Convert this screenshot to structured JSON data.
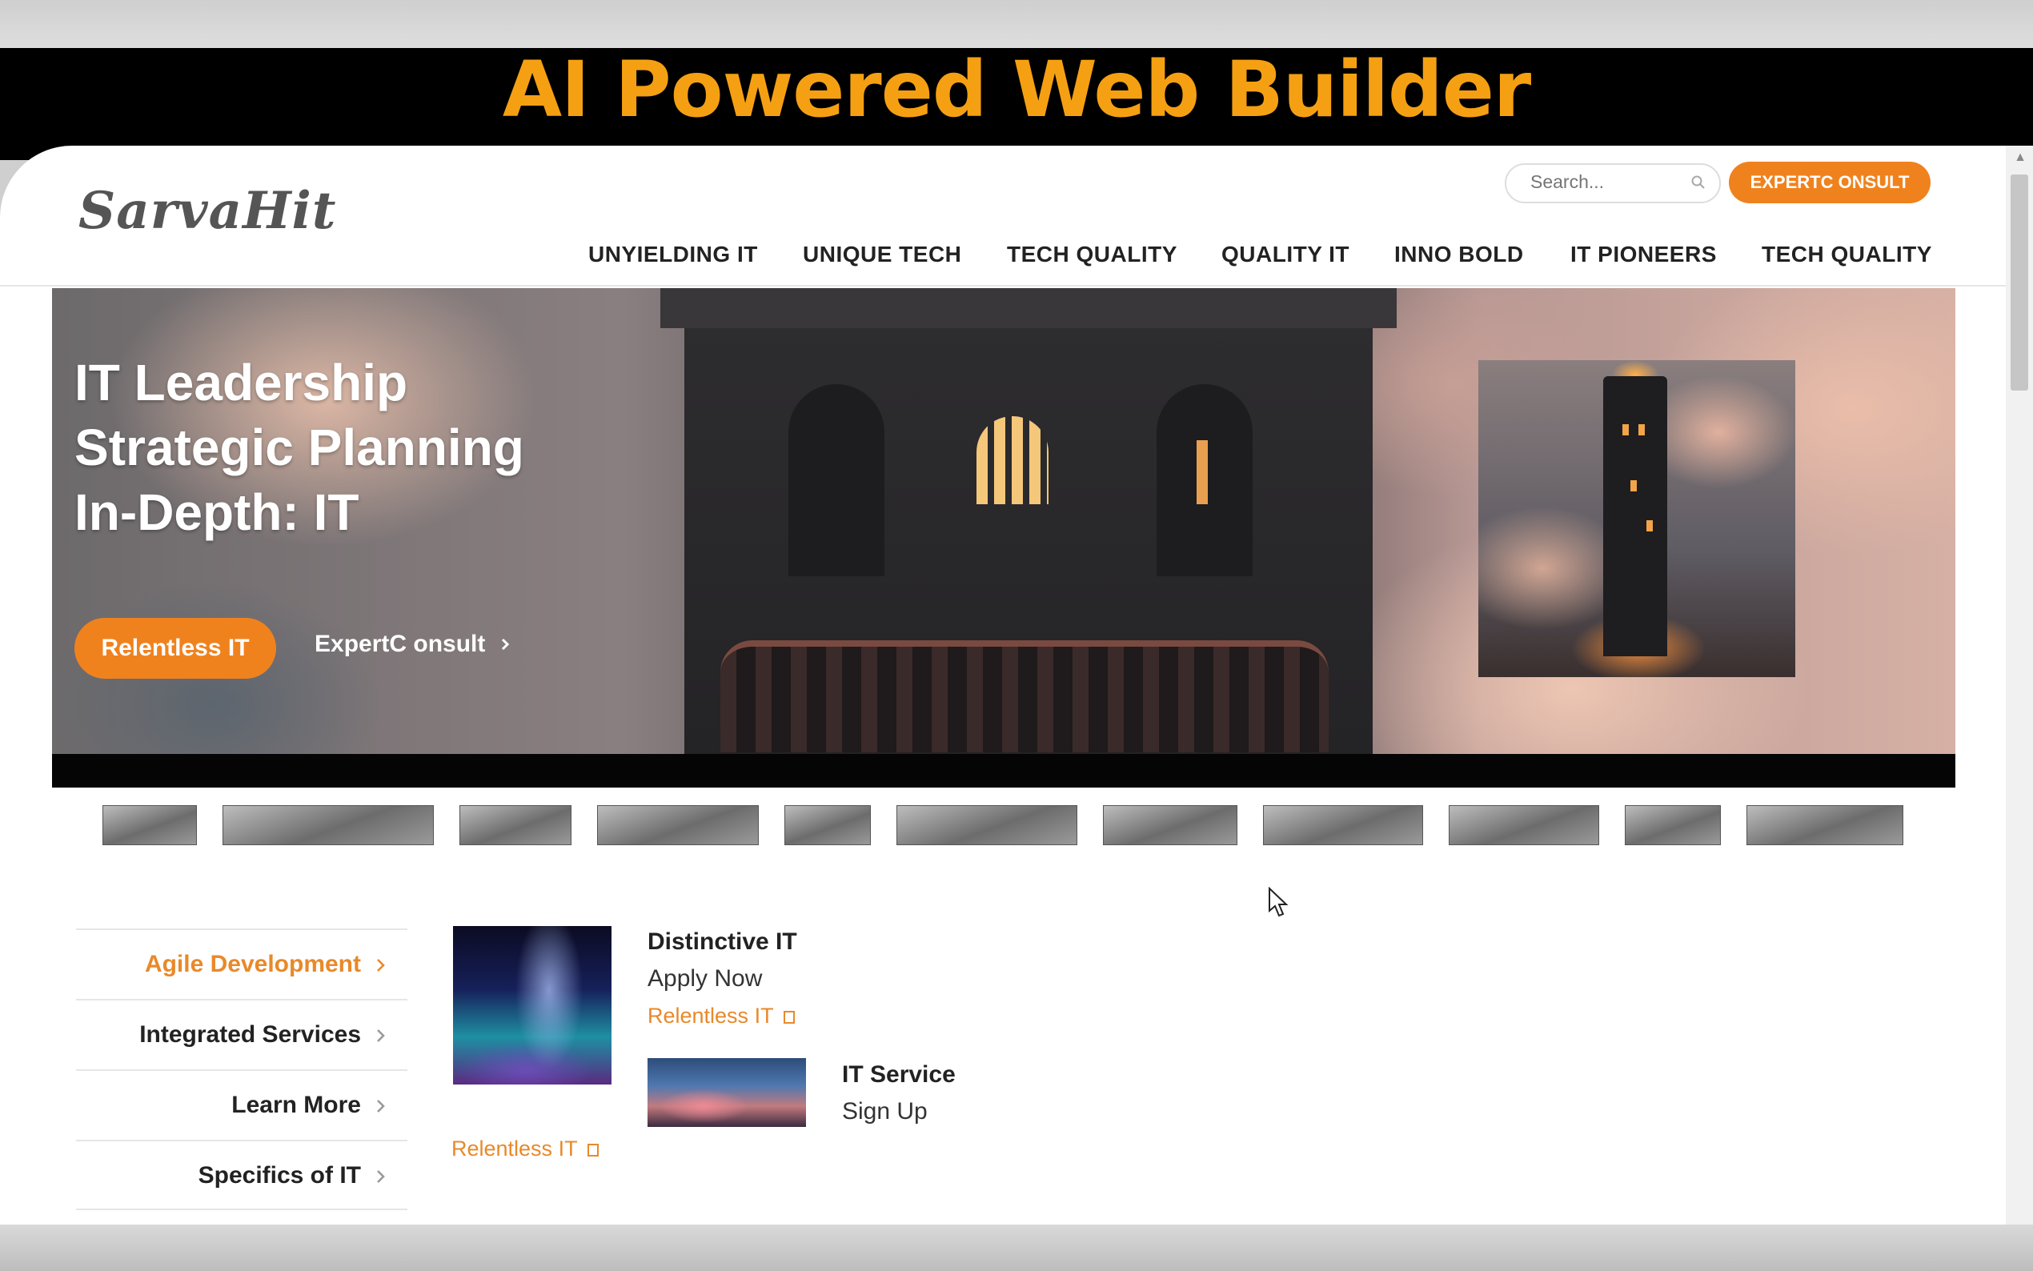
{
  "banner": {
    "title": "AI Powered Web Builder"
  },
  "header": {
    "logo": "SarvaHit",
    "search_placeholder": "Search...",
    "cta_label": "EXPERTC ONSULT",
    "nav": [
      "UNYIELDING IT",
      "UNIQUE TECH",
      "TECH QUALITY",
      "QUALITY IT",
      "INNO BOLD",
      "IT PIONEERS",
      "TECH QUALITY"
    ]
  },
  "hero": {
    "lines": [
      "IT Leadership",
      "Strategic Planning",
      "In-Depth: IT"
    ],
    "primary_button": "Relentless IT",
    "secondary_link": "ExpertC onsult"
  },
  "sidebar": {
    "items": [
      "Agile Development",
      "Integrated Services",
      "Learn More",
      "Specifics of IT"
    ],
    "active_index": 0
  },
  "features": [
    {
      "title": "Distinctive IT",
      "subtitle": "Apply Now",
      "link": "Relentless IT"
    },
    {
      "title": "IT Service",
      "subtitle": "Sign Up",
      "link": "Relentless IT"
    }
  ],
  "colors": {
    "accent": "#f0821e",
    "banner_text": "#f5a012"
  },
  "icons": [
    "search-icon",
    "chevron-right-icon",
    "external-link-icon",
    "cursor-icon"
  ]
}
